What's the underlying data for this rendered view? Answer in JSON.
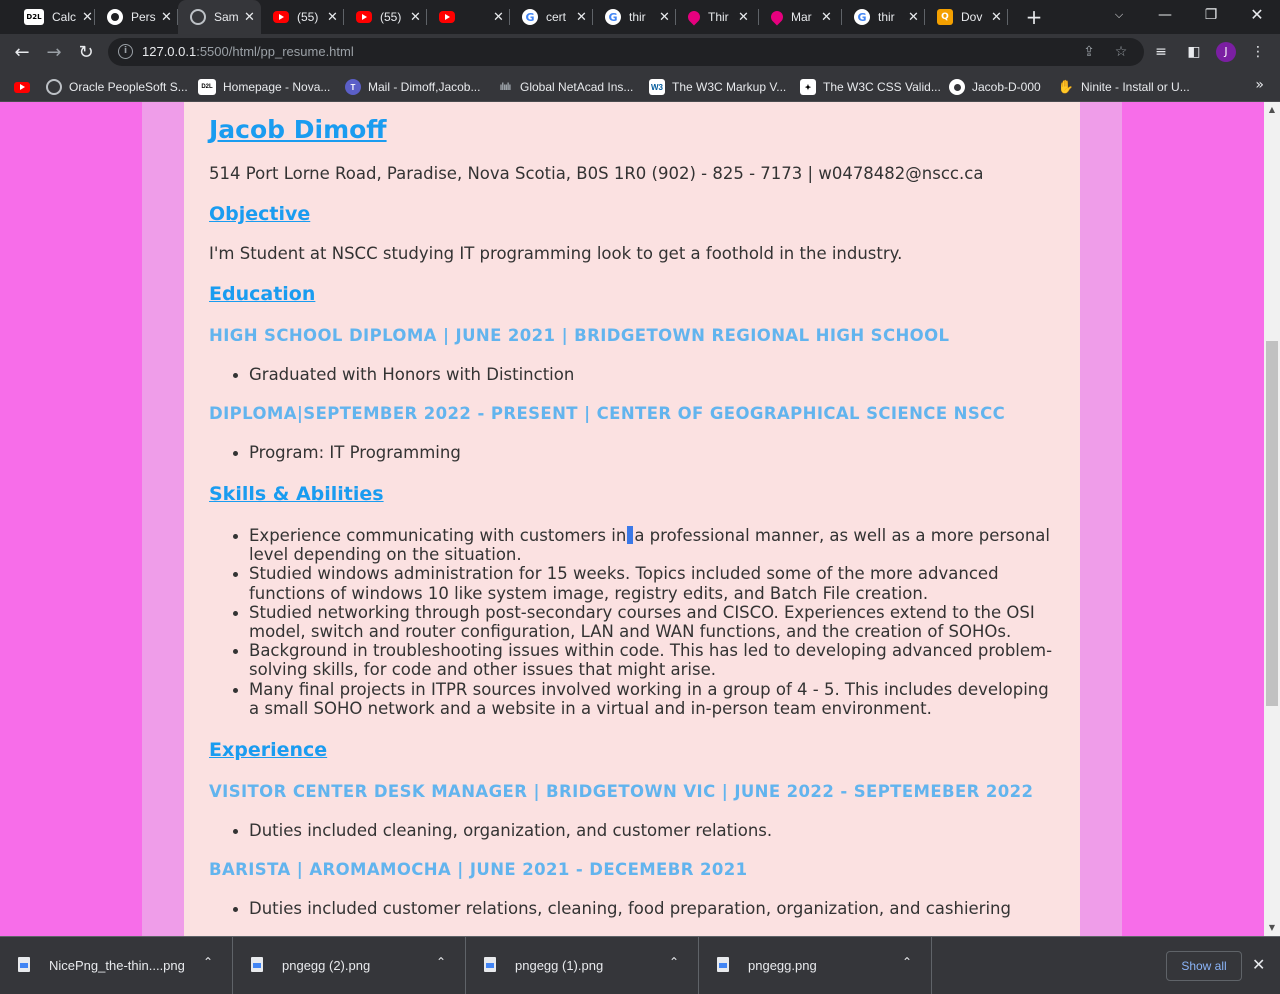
{
  "browser": {
    "tabs": [
      {
        "title": "Calc",
        "icon": "d2l-icon",
        "favtext": "D2L",
        "active": false
      },
      {
        "title": "Pers",
        "icon": "github-icon",
        "favtext": "",
        "active": false
      },
      {
        "title": "Sam",
        "icon": "globe-icon",
        "favtext": "",
        "active": true
      },
      {
        "title": "(55)",
        "icon": "youtube-icon",
        "favtext": "",
        "active": false
      },
      {
        "title": "(55)",
        "icon": "youtube-icon",
        "favtext": "",
        "active": false
      },
      {
        "title": "",
        "icon": "youtube-icon",
        "favtext": "",
        "active": false
      },
      {
        "title": "cert",
        "icon": "google-icon",
        "favtext": "G",
        "active": false
      },
      {
        "title": "thir",
        "icon": "google-icon",
        "favtext": "G",
        "active": false
      },
      {
        "title": "Thir",
        "icon": "drop-icon",
        "favtext": "",
        "active": false
      },
      {
        "title": "Mar",
        "icon": "drop-icon",
        "favtext": "",
        "active": false
      },
      {
        "title": "thir",
        "icon": "google-icon",
        "favtext": "G",
        "active": false
      },
      {
        "title": "Dov",
        "icon": "q-icon",
        "favtext": "Q",
        "active": false
      }
    ],
    "url_host": "127.0.0.1",
    "url_rest": ":5500/html/pp_resume.html",
    "avatar_letter": "J",
    "bookmarks": [
      {
        "label": "",
        "icon": "youtube-icon",
        "favtext": ""
      },
      {
        "label": "Oracle PeopleSoft S...",
        "icon": "globe-icon",
        "favtext": ""
      },
      {
        "label": "Homepage - Nova...",
        "icon": "d2l-icon",
        "favtext": "D2L"
      },
      {
        "label": "Mail - Dimoff,Jacob...",
        "icon": "teams-icon",
        "favtext": "T"
      },
      {
        "label": "Global NetAcad Ins...",
        "icon": "cisco-icon",
        "favtext": "ılıılı"
      },
      {
        "label": "The W3C Markup V...",
        "icon": "w3c-icon",
        "favtext": "W3"
      },
      {
        "label": "The W3C CSS Valid...",
        "icon": "css-icon",
        "favtext": "✦"
      },
      {
        "label": "Jacob-D-000",
        "icon": "github-icon",
        "favtext": ""
      },
      {
        "label": "Ninite - Install or U...",
        "icon": "ninite-icon",
        "favtext": "✋"
      }
    ],
    "bookmarks_more": "»"
  },
  "resume": {
    "name": "Jacob Dimoff",
    "contact": "514 Port Lorne Road, Paradise, Nova Scotia, B0S 1R0 (902) - 825 - 7173 | w0478482@nscc.ca",
    "objective_heading": "Objective",
    "objective_text": "I'm Student at NSCC studying IT programming look to get a foothold in the industry.",
    "education_heading": "Education",
    "edu1_title": "HIGH SCHOOL DIPLOMA | JUNE 2021 | BRIDGETOWN REGIONAL HIGH SCHOOL",
    "edu1_item": "Graduated with Honors with Distinction",
    "edu2_title": "DIPLOMA|SEPTEMBER 2022 - PRESENT | CENTER OF GEOGRAPHICAL SCIENCE NSCC",
    "edu2_item": "Program: IT Programming",
    "skills_heading": "Skills & Abilities",
    "skill1_a": "Experience communicating with customers in",
    "skill1_b": "a professional manner, as well as a more personal level depending on the situation.",
    "skill2": "Studied windows administration for 15 weeks. Topics included some of the more advanced functions of windows 10 like system image, registry edits, and Batch File creation.",
    "skill3": "Studied networking through post-secondary courses and CISCO. Experiences extend to the OSI model, switch and router configuration, LAN and WAN functions, and the creation of SOHOs.",
    "skill4": "Background in troubleshooting issues within code. This has led to developing advanced problem-solving skills, for code and other issues that might arise.",
    "skill5": "Many final projects in ITPR sources involved working in a group of 4 - 5. This includes developing a small SOHO network and a website in a virtual and in-person team environment.",
    "experience_heading": "Experience",
    "exp1_title": "VISITOR CENTER DESK MANAGER | BRIDGETOWN VIC | JUNE 2022 - SEPTEMEBER 2022",
    "exp1_item": "Duties included cleaning, organization, and customer relations.",
    "exp2_title": "BARISTA | AROMAMOCHA | JUNE 2021 - DECEMEBR 2021",
    "exp2_item": "Duties included customer relations, cleaning, food preparation, organization, and cashiering"
  },
  "downloads": {
    "files": [
      "NicePng_the-thin....png",
      "pngegg (2).png",
      "pngegg (1).png",
      "pngegg.png"
    ],
    "show_all": "Show all"
  }
}
